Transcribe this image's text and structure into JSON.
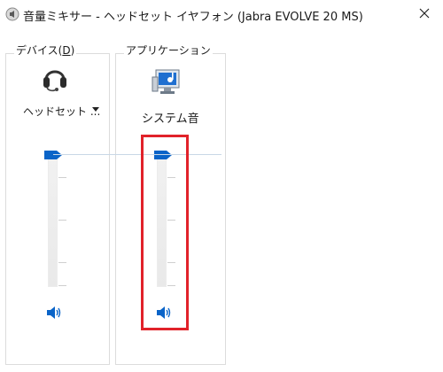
{
  "window": {
    "title": "音量ミキサー - ヘッドセット イヤフォン (Jabra EVOLVE 20 MS)",
    "close_glyph": "✕"
  },
  "device": {
    "group_label": "デバイス(",
    "accelerator": "D",
    "group_label_end": ")",
    "name": "ヘッドセット ...",
    "icon": "headset-icon",
    "volume_level": 1.0,
    "mute_icon": "speaker-icon"
  },
  "applications": {
    "group_label": "アプリケーション",
    "items": [
      {
        "name": "システム音",
        "icon": "system-sounds-icon",
        "volume_level": 1.0,
        "mute_icon": "speaker-icon"
      }
    ]
  },
  "colors": {
    "accent": "#0a64c8",
    "highlight": "#e1222a"
  }
}
